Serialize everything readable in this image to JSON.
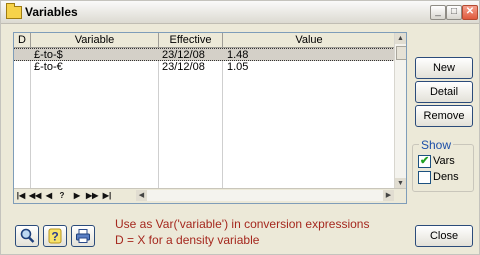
{
  "window": {
    "title": "Variables"
  },
  "grid": {
    "headers": [
      "D",
      "Variable",
      "Effective",
      "Value"
    ],
    "rows": [
      {
        "d": "",
        "variable": "£-to-$",
        "effective": "23/12/08",
        "value": "1.48",
        "selected": true
      },
      {
        "d": "",
        "variable": "£-to-€",
        "effective": "23/12/08",
        "value": "1.05",
        "selected": false
      }
    ]
  },
  "nav": [
    "|◀",
    "◀◀",
    "◀",
    "?",
    "▶",
    "▶▶",
    "▶|"
  ],
  "buttons": {
    "new": "New",
    "detail": "Detail",
    "remove": "Remove",
    "close": "Close"
  },
  "show": {
    "title": "Show",
    "vars": {
      "label": "Vars",
      "checked": true
    },
    "dens": {
      "label": "Dens",
      "checked": false
    }
  },
  "hints": [
    "Use as Var('variable') in conversion expressions",
    "D = X for a density variable"
  ],
  "icons": {
    "search": "magnifier-icon",
    "help": "help-icon",
    "print": "printer-icon"
  }
}
